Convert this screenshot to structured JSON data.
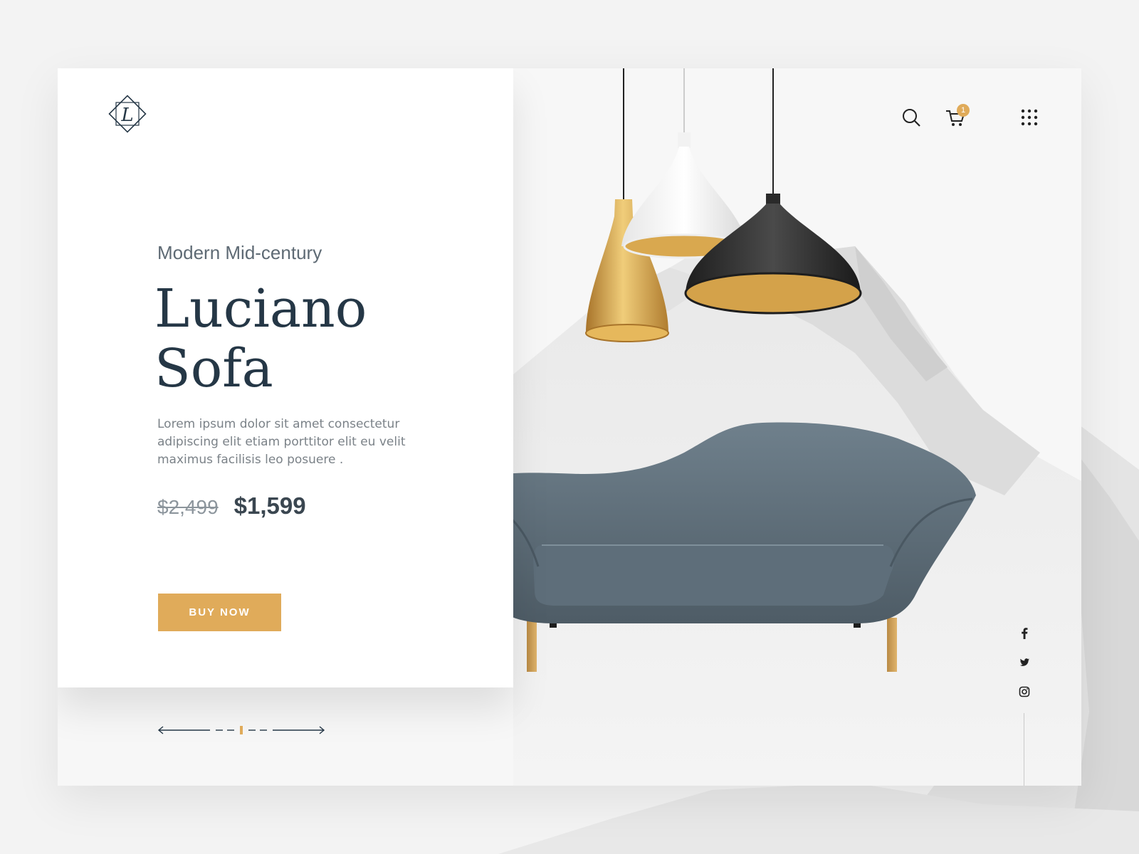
{
  "brand": {
    "logo_letter": "L"
  },
  "hero": {
    "subtitle": "Modern Mid-century",
    "title_line1": "Luciano",
    "title_line2": "Sofa",
    "description": "Lorem ipsum dolor sit amet consectetur adipiscing elit etiam porttitor elit eu velit maximus facilisis leo posuere .",
    "old_price": "$2,499",
    "new_price": "$1,599",
    "buy_label": "BUY NOW"
  },
  "header": {
    "cart_count": "1",
    "icons": [
      "search-icon",
      "cart-icon",
      "grid-menu-icon"
    ]
  },
  "social": {
    "icons": [
      "facebook-icon",
      "twitter-icon",
      "instagram-icon"
    ]
  },
  "colors": {
    "accent": "#e0ab5a",
    "title": "#253746",
    "text": "#7b8288",
    "sofa": "#5d6d79",
    "lamp_gold": "#c9963a",
    "lamp_black": "#2c2c2c"
  }
}
